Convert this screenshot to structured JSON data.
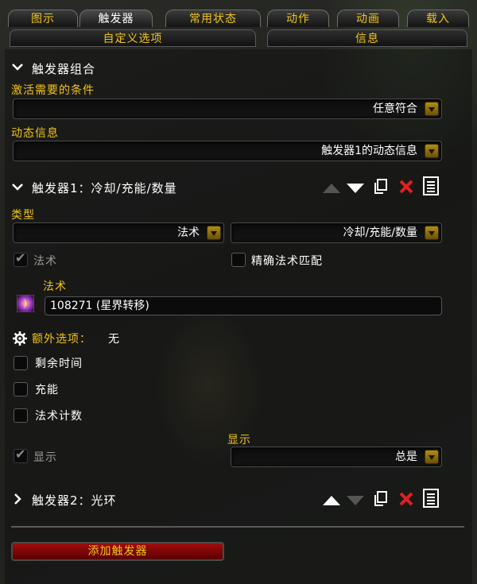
{
  "tabs": [
    {
      "label": "图示",
      "active": false
    },
    {
      "label": "触发器",
      "active": true
    },
    {
      "label": "常用状态",
      "active": false
    },
    {
      "label": "动作",
      "active": false
    },
    {
      "label": "动画",
      "active": false
    },
    {
      "label": "载入",
      "active": false
    }
  ],
  "subtabs": [
    {
      "label": "自定义选项"
    },
    {
      "label": "信息"
    }
  ],
  "trigger_group": {
    "title": "触发器组合",
    "activation_label": "激活需要的条件",
    "activation_value": "任意符合",
    "dynamic_label": "动态信息",
    "dynamic_value": "触发器1的动态信息"
  },
  "trigger1": {
    "title": "触发器1：冷却/充能/数量",
    "type_label": "类型",
    "type_value": "法术",
    "subtype_value": "冷却/充能/数量",
    "spell_checkbox": "法术",
    "exact_checkbox": "精确法术匹配",
    "spell_label": "法术",
    "spell_value": "108271 (星界转移)",
    "extra_label": "额外选项：",
    "extra_value": "无",
    "opt_remaining": "剩余时间",
    "opt_charges": "充能",
    "opt_spellcount": "法术计数",
    "show_checkbox": "显示",
    "show_label": "显示",
    "show_value": "总是"
  },
  "trigger2": {
    "title": "触发器2：光环"
  },
  "add_button": "添加触发器",
  "colors": {
    "accent": "#f0c419",
    "delete": "#e02020",
    "add_button": "#a00d0d"
  },
  "icons": [
    "chevron-down-icon",
    "chevron-right-icon",
    "move-up-icon",
    "move-down-icon",
    "duplicate-icon",
    "delete-icon",
    "notes-icon",
    "gear-icon",
    "spell-icon",
    "dropdown-arrow-icon"
  ]
}
